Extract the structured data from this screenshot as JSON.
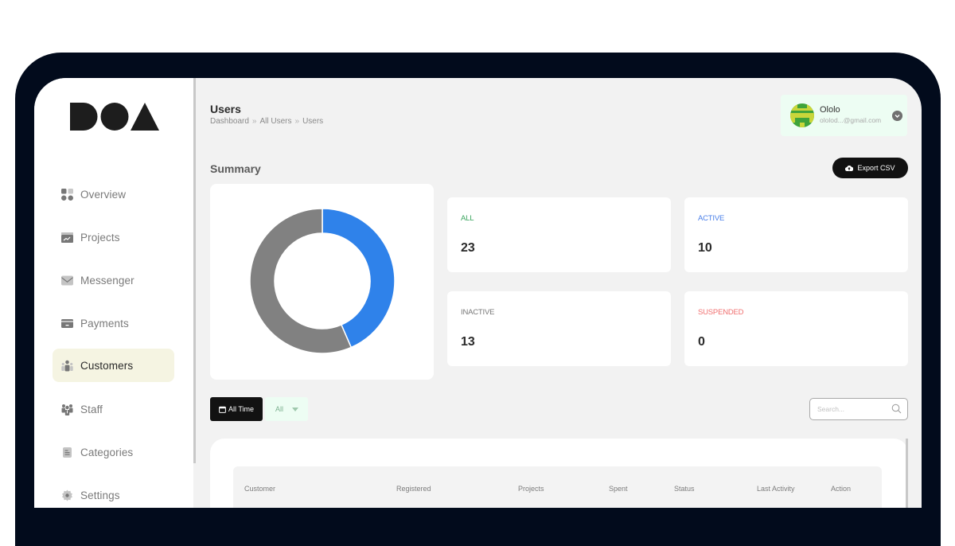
{
  "brand": {
    "logo_text": "DOA"
  },
  "sidebar": {
    "items": [
      {
        "label": "Overview",
        "icon": "grid-icon",
        "active": false
      },
      {
        "label": "Projects",
        "icon": "folder-chart-icon",
        "active": false
      },
      {
        "label": "Messenger",
        "icon": "envelope-icon",
        "active": false
      },
      {
        "label": "Payments",
        "icon": "wallet-icon",
        "active": false
      },
      {
        "label": "Customers",
        "icon": "users-icon",
        "active": true
      },
      {
        "label": "Staff",
        "icon": "staff-group-icon",
        "active": false
      },
      {
        "label": "Categories",
        "icon": "document-list-icon",
        "active": false
      },
      {
        "label": "Settings",
        "icon": "gear-icon",
        "active": false
      }
    ]
  },
  "header": {
    "title": "Users",
    "breadcrumb": [
      "Dashboard",
      "All Users",
      "Users"
    ],
    "breadcrumb_separator": "»"
  },
  "user": {
    "name": "Ololo",
    "email": "ololod...@gmail.com"
  },
  "summary": {
    "title": "Summary",
    "export_label": "Export CSV",
    "stats": [
      {
        "label": "ALL",
        "value": "23",
        "color": "#3aa55e"
      },
      {
        "label": "ACTIVE",
        "value": "10",
        "color": "#4a7fe8"
      },
      {
        "label": "INACTIVE",
        "value": "13",
        "color": "#777777"
      },
      {
        "label": "SUSPENDED",
        "value": "0",
        "color": "#f07070"
      }
    ]
  },
  "chart_data": {
    "type": "pie",
    "variant": "donut",
    "title": "",
    "categories": [
      "Active",
      "Inactive"
    ],
    "values": [
      10,
      13
    ],
    "colors": [
      "#2f82ea",
      "#818181"
    ],
    "legend": "none"
  },
  "filters": {
    "time_label": "All Time",
    "status_selected": "All",
    "search_placeholder": "Search...",
    "search_value": ""
  },
  "table": {
    "columns": [
      "Customer",
      "Registered",
      "Projects",
      "Spent",
      "Status",
      "Last Activity",
      "Action"
    ],
    "rows": []
  }
}
